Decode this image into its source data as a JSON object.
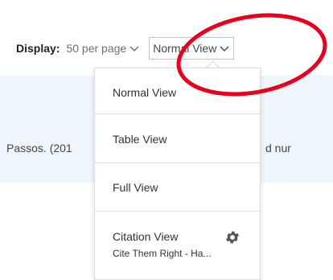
{
  "display_bar": {
    "label": "Display:",
    "per_page": "50 per page",
    "selected_view": "Normal View"
  },
  "result": {
    "text_left": "Passos. (201",
    "text_right": "d nur"
  },
  "view_menu": {
    "items": [
      {
        "label": "Normal View"
      },
      {
        "label": "Table View"
      },
      {
        "label": "Full View"
      },
      {
        "label": "Citation View",
        "sub": "Cite Them Right - Ha..."
      }
    ]
  },
  "colors": {
    "annotation": "#e8001c",
    "band": "#eef5fb"
  }
}
